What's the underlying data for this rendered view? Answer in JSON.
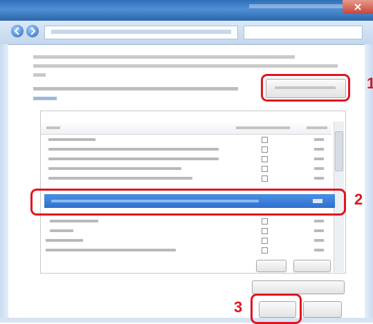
{
  "callouts": {
    "one": "1",
    "two": "2",
    "three": "3"
  },
  "colors": {
    "callout": "#e0141e",
    "selection": "#2f6fcf",
    "titlebar": "#2f6fb8"
  },
  "icons": {
    "back": "back-icon",
    "forward": "forward-icon",
    "dropdown": "chevron-down-icon",
    "close": "close-icon",
    "checkbox": "checkbox-icon"
  }
}
